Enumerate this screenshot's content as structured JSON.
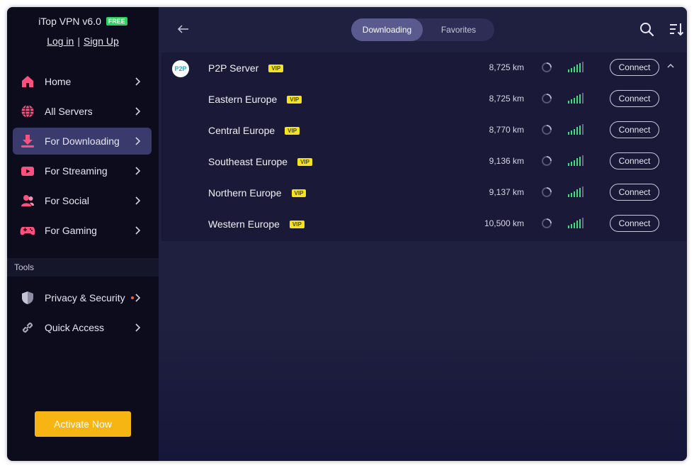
{
  "app": {
    "title": "iTop VPN v6.0",
    "badge": "FREE"
  },
  "auth": {
    "login": "Log in",
    "separator": "|",
    "signup": "Sign Up"
  },
  "sidebar": {
    "items": [
      {
        "label": "Home",
        "icon": "home-icon"
      },
      {
        "label": "All Servers",
        "icon": "globe-icon"
      },
      {
        "label": "For Downloading",
        "icon": "download-icon",
        "active": true
      },
      {
        "label": "For Streaming",
        "icon": "play-icon"
      },
      {
        "label": "For Social",
        "icon": "users-icon"
      },
      {
        "label": "For Gaming",
        "icon": "gamepad-icon"
      }
    ],
    "tools_header": "Tools",
    "tools": [
      {
        "label": "Privacy & Security",
        "icon": "shield-icon",
        "has_dot": true
      },
      {
        "label": "Quick Access",
        "icon": "link-icon"
      }
    ],
    "activate": "Activate Now"
  },
  "header": {
    "tabs": [
      {
        "label": "Downloading",
        "active": true
      },
      {
        "label": "Favorites",
        "active": false
      }
    ]
  },
  "servers": [
    {
      "icon_text": "P2P",
      "name": "P2P Server",
      "vip": "VIP",
      "distance": "8,725 km",
      "action": "Connect"
    },
    {
      "name": "Eastern Europe",
      "vip": "VIP",
      "distance": "8,725 km",
      "action": "Connect"
    },
    {
      "name": "Central Europe",
      "vip": "VIP",
      "distance": "8,770 km",
      "action": "Connect"
    },
    {
      "name": "Southeast Europe",
      "vip": "VIP",
      "distance": "9,136 km",
      "action": "Connect"
    },
    {
      "name": "Northern Europe",
      "vip": "VIP",
      "distance": "9,137 km",
      "action": "Connect"
    },
    {
      "name": "Western Europe",
      "vip": "VIP",
      "distance": "10,500 km",
      "action": "Connect"
    }
  ],
  "colors": {
    "accent": "#f7b514",
    "signal": "#3ee07a",
    "vip": "#f5e31e",
    "free_badge": "#2ed060",
    "sidebar_bg": "#0c0c1c",
    "main_bg": "#1f1f3f"
  }
}
